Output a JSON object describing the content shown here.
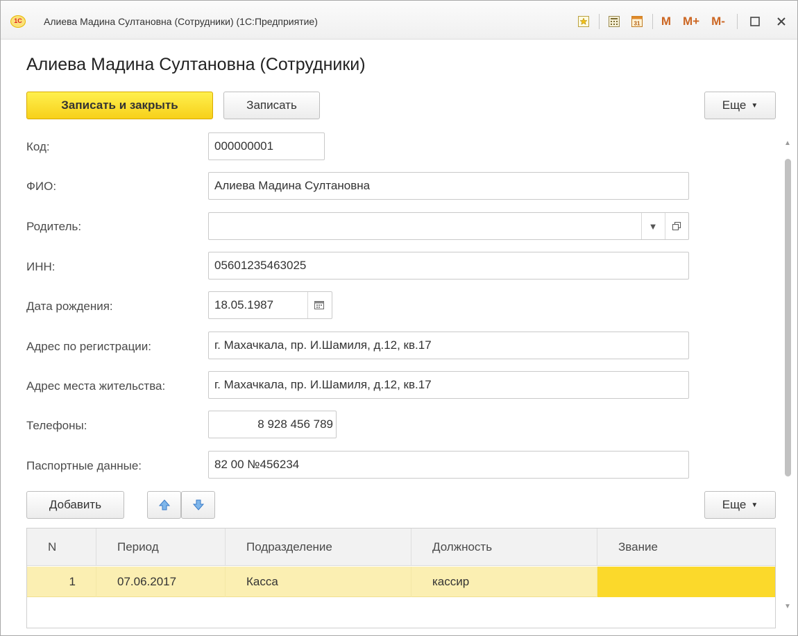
{
  "window": {
    "title": "Алиева Мадина Султановна (Сотрудники)  (1С:Предприятие)",
    "logo_text": "1С",
    "toolbar": {
      "favorite_icon": "star-icon",
      "calculator_icon": "calculator-icon",
      "calendar_icon": "calendar-icon",
      "m_label": "M",
      "mplus_label": "M+",
      "mminus_label": "M-",
      "maximize_icon": "maximize-icon",
      "close_icon": "close-icon"
    }
  },
  "form": {
    "title": "Алиева Мадина Султановна (Сотрудники)",
    "buttons": {
      "save_close": "Записать и закрыть",
      "save": "Записать",
      "more": "Еще"
    },
    "fields": {
      "code": {
        "label": "Код:",
        "value": "000000001"
      },
      "fio": {
        "label": "ФИО:",
        "value": "Алиева Мадина Султановна"
      },
      "parent": {
        "label": "Родитель:",
        "value": ""
      },
      "inn": {
        "label": "ИНН:",
        "value": "05601235463025"
      },
      "birth_date": {
        "label": "Дата рождения:",
        "value": "18.05.1987"
      },
      "reg_address": {
        "label": "Адрес по регистрации:",
        "value": "г. Махачкала, пр. И.Шамиля, д.12, кв.17"
      },
      "live_address": {
        "label": "Адрес места жительства:",
        "value": "г. Махачкала, пр. И.Шамиля, д.12, кв.17"
      },
      "phones": {
        "label": "Телефоны:",
        "value": "8 928 456 789"
      },
      "passport": {
        "label": "Паспортные данные:",
        "value": "82 00 №456234"
      }
    },
    "table_toolbar": {
      "add": "Добавить",
      "move_up_icon": "arrow-up-icon",
      "move_down_icon": "arrow-down-icon",
      "more": "Еще"
    },
    "table": {
      "columns": [
        "N",
        "Период",
        "Подразделение",
        "Должность",
        "Звание"
      ],
      "rows": [
        [
          "1",
          "07.06.2017",
          "Касса",
          "кассир",
          ""
        ]
      ]
    }
  }
}
